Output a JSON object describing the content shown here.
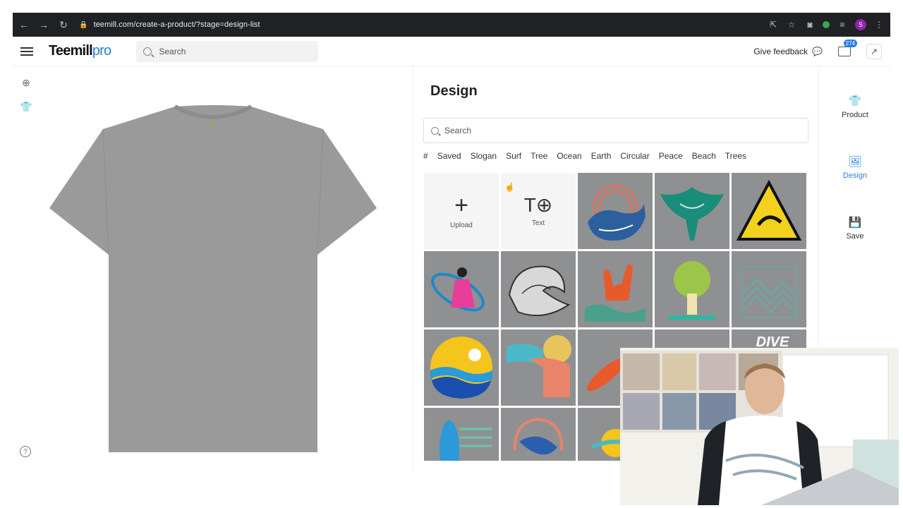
{
  "browser": {
    "url": "teemill.com/create-a-product/?stage=design-list",
    "profile_initial": "S"
  },
  "header": {
    "logo_main": "Teemill",
    "logo_sub": "pro",
    "search_placeholder": "Search",
    "feedback_label": "Give feedback",
    "notifications_count": "274"
  },
  "panel": {
    "title": "Design",
    "search_placeholder": "Search",
    "tags": [
      "#",
      "Saved",
      "Slogan",
      "Surf",
      "Tree",
      "Ocean",
      "Earth",
      "Circular",
      "Peace",
      "Beach",
      "Trees"
    ],
    "upload_label": "Upload",
    "text_label": "Text",
    "partial_tile_text": "DIVE"
  },
  "sidebar": {
    "items": [
      {
        "label": "Product",
        "icon": "tshirt-icon"
      },
      {
        "label": "Design",
        "icon": "image-icon"
      },
      {
        "label": "Save",
        "icon": "save-icon"
      }
    ],
    "active": "Design"
  },
  "colors": {
    "accent": "#2a7fe0",
    "tile_bg": "#8f9092",
    "shirt": "#9a9a9a"
  }
}
